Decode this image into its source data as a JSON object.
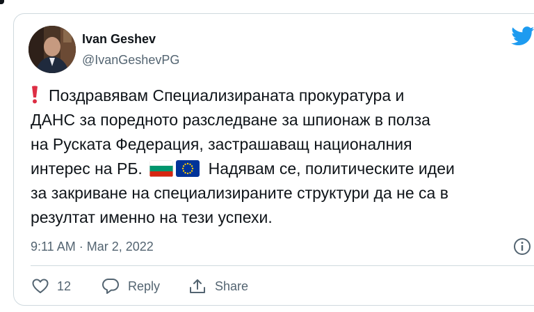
{
  "tweet": {
    "author": {
      "name": "Ivan Geshev",
      "handle": "@IvanGeshevPG"
    },
    "text_lines": [
      "Поздравявам Специализираната прокуратура и",
      "ДАНС за поредното разследване за шпионаж в полза",
      "на Руската Федерация, застрашаващ националния",
      "интерес на РБ.",
      "Надявам се, политическите идеи",
      "за закриване на специализираните структури да не са в",
      "резултат именно на тези успехи."
    ],
    "timestamp": "9:11 AM · Mar 2, 2022",
    "actions": {
      "like_count": "12",
      "reply_label": "Reply",
      "share_label": "Share"
    }
  },
  "icons": {
    "brand": "twitter-bird-icon",
    "emphasis": "red-exclamation-icon",
    "flags": [
      "bulgaria-flag-icon",
      "eu-flag-icon"
    ],
    "info": "info-icon",
    "like": "heart-icon",
    "reply": "reply-bubble-icon",
    "share": "share-icon"
  },
  "colors": {
    "brand_blue": "#1d9bf0",
    "text_primary": "#0f1419",
    "text_secondary": "#536471",
    "border": "#cfd9de",
    "exclamation_red": "#dd2e44"
  }
}
